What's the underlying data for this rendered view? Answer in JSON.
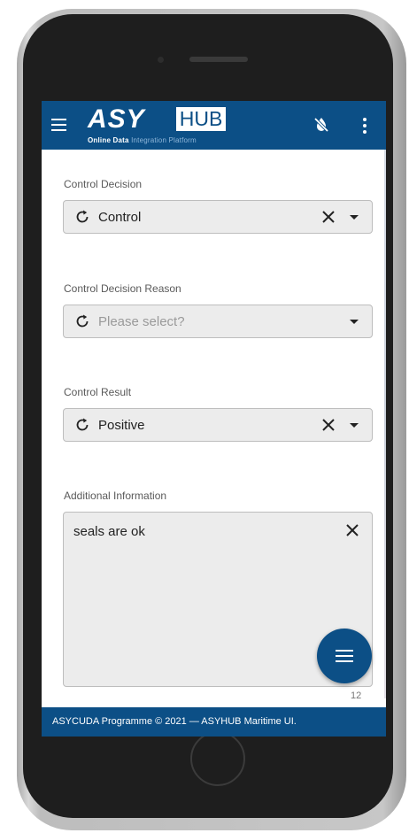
{
  "header": {
    "logo_main": "ASY",
    "logo_hub": "HUB",
    "logo_sub_bold": "Online Data",
    "logo_sub_light": "Integration Platform",
    "menu_icon": "hamburger-menu-icon",
    "sync_icon": "sync-disabled-icon",
    "more_icon": "more-vertical-icon"
  },
  "form": {
    "control_decision": {
      "label": "Control Decision",
      "value": "Control"
    },
    "control_decision_reason": {
      "label": "Control Decision Reason",
      "placeholder": "Please select?"
    },
    "control_result": {
      "label": "Control Result",
      "value": "Positive"
    },
    "additional_information": {
      "label": "Additional Information",
      "value": "seals are ok",
      "char_count": "12"
    }
  },
  "fab": {
    "icon": "menu-icon"
  },
  "footer": {
    "text": "ASYCUDA Programme © 2021 — ASYHUB Maritime UI."
  },
  "colors": {
    "primary": "#0c4f86",
    "field_bg": "#ececec"
  }
}
